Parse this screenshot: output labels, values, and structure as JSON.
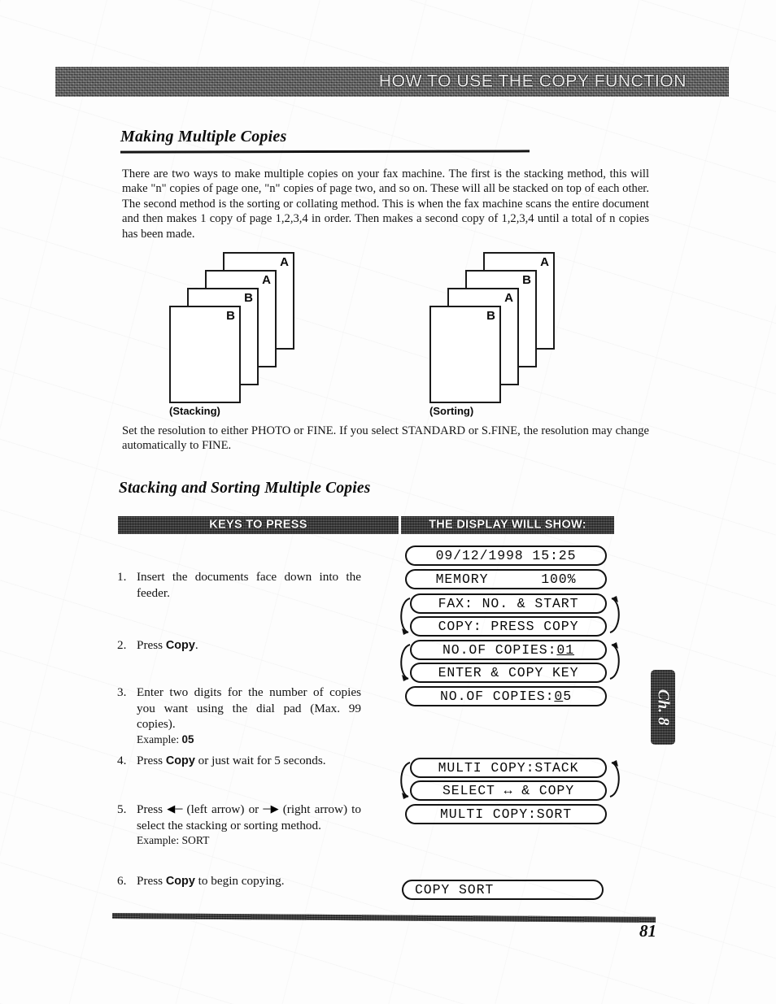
{
  "header": {
    "running_head": "HOW TO USE THE COPY FUNCTION"
  },
  "section_1": {
    "heading": "Making Multiple Copies",
    "paragraph": "There are two ways to make multiple copies on your fax machine.  The first is the stacking method, this will make \"n\" copies of page one, \"n\" copies of page two, and so on. These will all be stacked on top of each other. The second method is the sorting or collating method. This is when the fax machine scans the entire document and then makes 1 copy of page 1,2,3,4 in order. Then makes a second copy of 1,2,3,4 until a total of n copies has been made.",
    "resolution_note": "Set the resolution to either PHOTO or FINE. If you select STANDARD or S.FINE, the resolution may change automatically to FINE."
  },
  "diagrams": [
    {
      "name": "stacking",
      "caption": "(Stacking)",
      "sheets": [
        "A",
        "A",
        "B",
        "B"
      ]
    },
    {
      "name": "sorting",
      "caption": "(Sorting)",
      "sheets": [
        "A",
        "B",
        "A",
        "B"
      ]
    }
  ],
  "section_2": {
    "heading": "Stacking and Sorting Multiple Copies",
    "col_keys_label": "KEYS TO PRESS",
    "col_display_label": "THE DISPLAY WILL SHOW:"
  },
  "steps": [
    {
      "num": "1.",
      "text": "Insert the documents face down into the feeder.",
      "example": ""
    },
    {
      "num": "2.",
      "text_pre": "Press ",
      "bold": "Copy",
      "text_post": ".",
      "example": ""
    },
    {
      "num": "3.",
      "text": "Enter two digits for the number of copies you want using the dial pad (Max. 99 copies).",
      "example_label": "Example: ",
      "example_value": "05"
    },
    {
      "num": "4.",
      "text_pre": "Press ",
      "bold": "Copy",
      "text_post": " or just wait for 5 seconds.",
      "example": ""
    },
    {
      "num": "5.",
      "text_pre": "Press ",
      "left_arrow": "◀─",
      "text_mid": " (left arrow) or ",
      "right_arrow": "─▶",
      "text_post": " (right arrow) to select the stacking or sorting method.",
      "example_label": "Example: SORT",
      "example_value": ""
    },
    {
      "num": "6.",
      "text_pre": "Press ",
      "bold": "Copy",
      "text_post": " to begin copying.",
      "example": ""
    }
  ],
  "displays": {
    "datetime": "09/12/1998 15:25",
    "memory": "MEMORY      100%",
    "fax": "FAX: NO. & START",
    "copy_press": "COPY: PRESS COPY",
    "copies_01_prefix": "NO.OF COPIES:",
    "copies_01_value": "01",
    "enter_copy_key": "ENTER & COPY KEY",
    "copies_05_prefix": "NO.OF COPIES:",
    "copies_05_cursor": "0",
    "copies_05_rest": "5",
    "multi_stack": "MULTI COPY:STACK",
    "select_copy": "SELECT ↔ & COPY",
    "multi_sort": "MULTI COPY:SORT",
    "copy_sort": "COPY SORT"
  },
  "chapter_tab": {
    "label": "Ch. 8"
  },
  "footer": {
    "page_number": "81"
  }
}
